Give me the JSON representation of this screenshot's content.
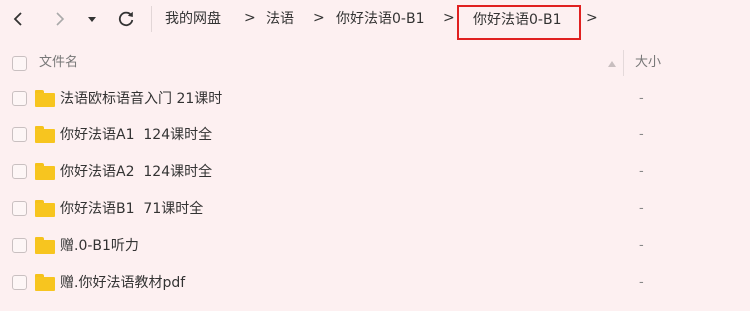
{
  "toolbar": {
    "back_icon": "chevron-left-icon",
    "forward_icon": "chevron-right-icon",
    "history_icon": "caret-down-icon",
    "refresh_icon": "refresh-icon"
  },
  "breadcrumb": {
    "items": [
      "我的网盘",
      "法语",
      "你好法语0-B1"
    ],
    "separator": ">",
    "current": "你好法语0-B1",
    "highlight_color": "#e02020"
  },
  "table": {
    "headers": {
      "name": "文件名",
      "size": "大小"
    },
    "rows": [
      {
        "name": "法语欧标语音入门 21课时",
        "size": "-"
      },
      {
        "name": "你好法语A1  124课时全",
        "size": "-"
      },
      {
        "name": "你好法语A2  124课时全",
        "size": "-"
      },
      {
        "name": "你好法语B1  71课时全",
        "size": "-"
      },
      {
        "name": "赠.0-B1听力",
        "size": "-"
      },
      {
        "name": "赠.你好法语教材pdf",
        "size": "-"
      }
    ]
  },
  "colors": {
    "background": "#fdf0f1",
    "folder": "#f7c51f"
  }
}
